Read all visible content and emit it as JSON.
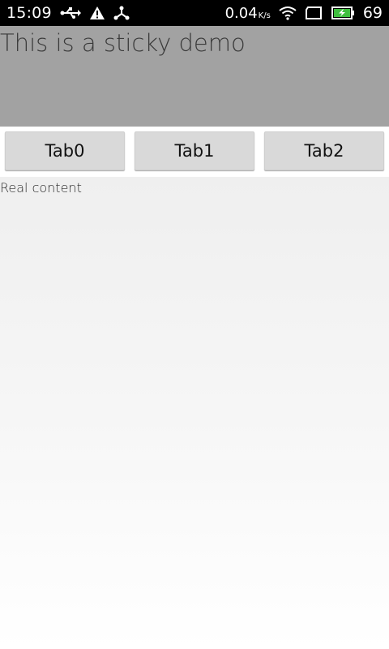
{
  "status_bar": {
    "time": "15:09",
    "net_speed": "0.04",
    "net_speed_unit": "K/s",
    "battery_percent": "69",
    "icons": [
      "usb-icon",
      "warning-icon",
      "share-icon",
      "wifi-icon",
      "screen-icon",
      "battery-charging-icon"
    ]
  },
  "header": {
    "title": "This is a sticky demo",
    "background_color": "#a2a2a2"
  },
  "tabs": [
    {
      "label": "Tab0"
    },
    {
      "label": "Tab1"
    },
    {
      "label": "Tab2"
    }
  ],
  "content": {
    "text": "Real content"
  },
  "colors": {
    "battery_fill": "#3fbf3f"
  }
}
